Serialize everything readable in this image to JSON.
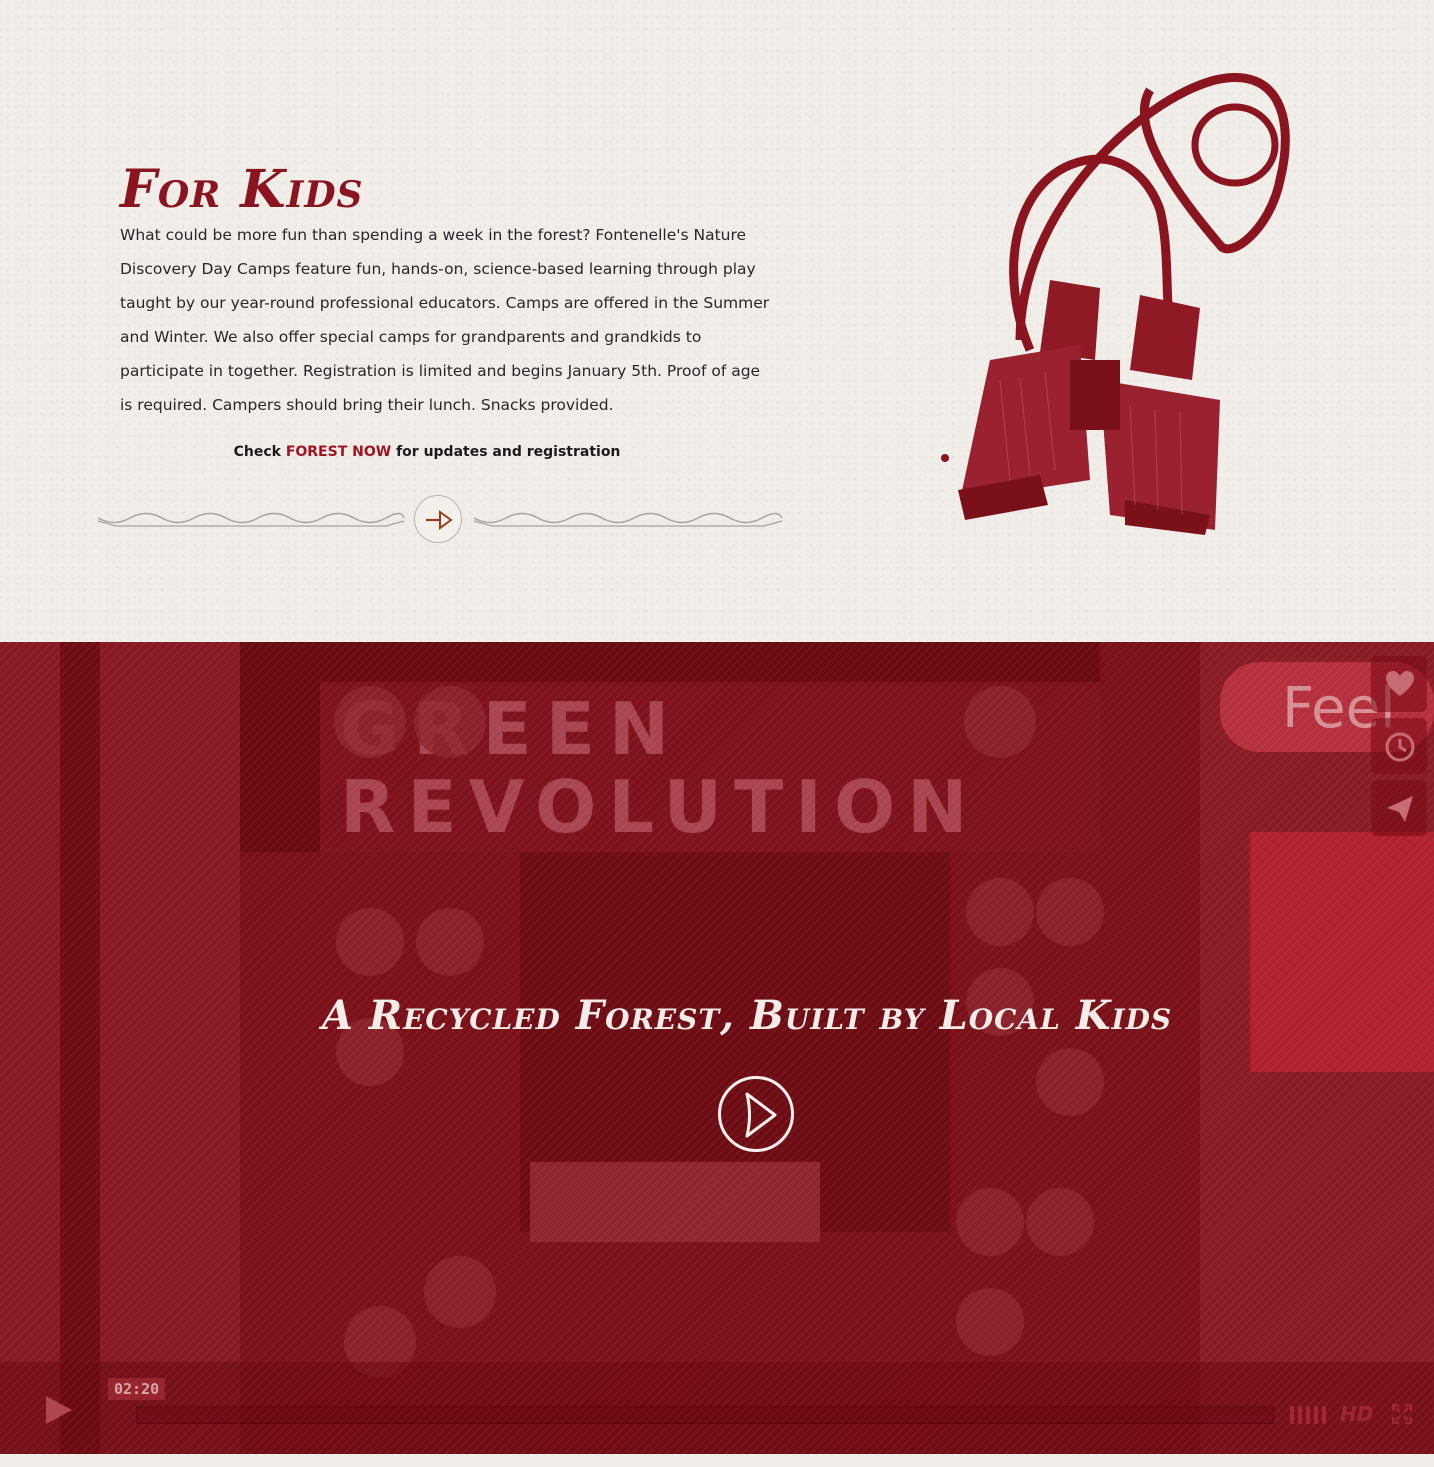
{
  "kids": {
    "title": "For Kids",
    "paragraph": "What could be more fun than spending a week in the forest? Fontenelle's Nature Discovery Day Camps feature fun, hands-on, science-based learning through play taught by our year-round professional educators. Camps are offered in the Summer and Winter. We also offer special camps for grandparents and grandkids to participate in together. Registration is limited and begins January 5th. Proof of age is required. Campers should bring their lunch. Snacks provided.",
    "cta_prefix": "Check ",
    "cta_link": "FOREST NOW",
    "cta_suffix": " for updates and registration",
    "next_icon": "arrow-right-icon",
    "illustration": "binoculars-illustration"
  },
  "video": {
    "title": "A Recycled Forest, Built by Local Kids",
    "background_sign_text": "GREEN REVOLUTION",
    "timecode": "02:20",
    "quality_label": "HD",
    "progress": 0.0,
    "side_actions": [
      "heart-icon",
      "clock-icon",
      "send-icon"
    ]
  },
  "colors": {
    "accent": "#8a1420",
    "link": "#a0141f",
    "video_tint": "#7a1019",
    "paper": "#f1eeea"
  }
}
